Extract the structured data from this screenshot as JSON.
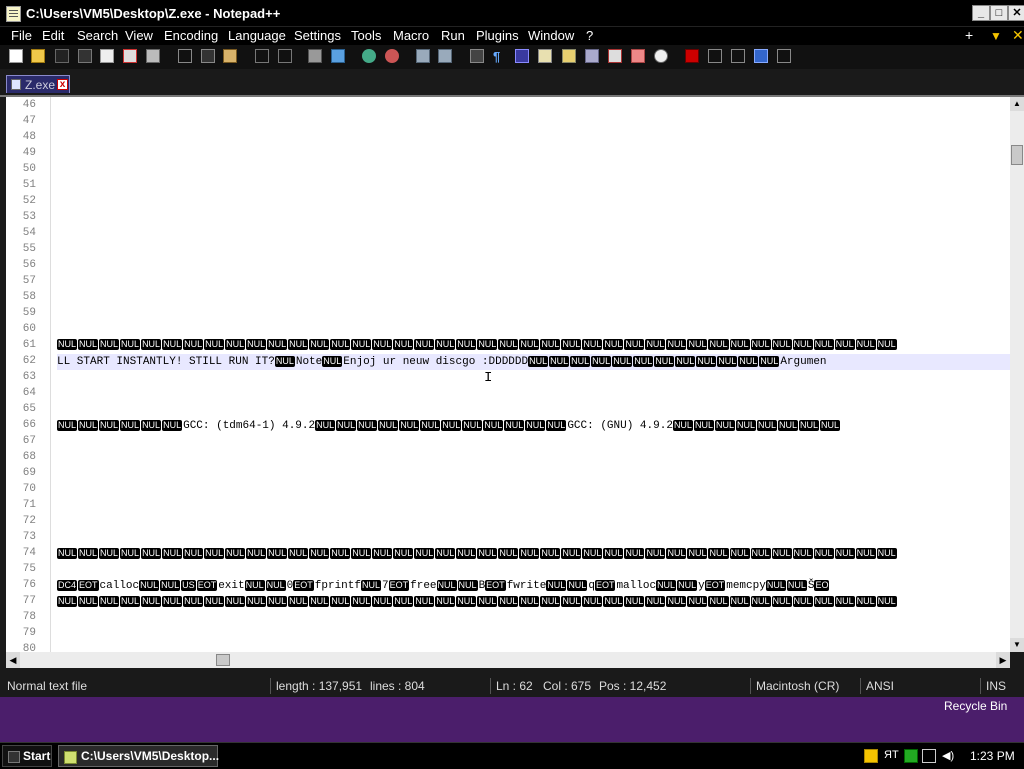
{
  "window": {
    "title": "C:\\Users\\VM5\\Desktop\\Z.exe - Notepad++",
    "minimize_label": "_",
    "maximize_label": "□",
    "close_label": "✕"
  },
  "menu": {
    "items": [
      "File",
      "Edit",
      "Search",
      "View",
      "Encoding",
      "Language",
      "Settings",
      "Tools",
      "Macro",
      "Run",
      "Plugins",
      "Window",
      "?"
    ],
    "plus": "+",
    "dropdown": "▼",
    "close": "✕"
  },
  "tab": {
    "label": "Z.exe",
    "close_label": "x"
  },
  "editor": {
    "line_numbers": [
      "46",
      "47",
      "48",
      "49",
      "50",
      "51",
      "52",
      "53",
      "54",
      "55",
      "56",
      "57",
      "58",
      "59",
      "60",
      "61",
      "62",
      "63",
      "64",
      "65",
      "66",
      "67",
      "68",
      "69",
      "70",
      "71",
      "72",
      "73",
      "74",
      "75",
      "76",
      "77",
      "78",
      "79",
      "80"
    ],
    "line62_text_a": "LL START INSTANTLY! STILL RUN IT?",
    "line62_text_b": "Note",
    "line62_text_c": "Enjoj ur neuw discgo :DDDDDD",
    "line62_text_d": "Argumen",
    "line66_text_a": "GCC: (tdm64-1) 4.9.2",
    "line66_text_b": "GCC: (GNU) 4.9.2",
    "line76_tokens": [
      "DC4",
      "EOT",
      "calloc",
      "NUL",
      "NUL",
      "US",
      "EOT",
      "exit",
      "NUL",
      "NUL",
      "0",
      "EOT",
      "fprintf",
      "NUL",
      "7",
      "EOT",
      "free",
      "NUL",
      "NUL",
      "B",
      "EOT",
      "fwrite",
      "NUL",
      "NUL",
      "q",
      "EOT",
      "malloc",
      "NUL",
      "NUL",
      "y",
      "EOT",
      "memcpy",
      "NUL",
      "NUL",
      "Š",
      "EO"
    ],
    "nul_label": "NUL",
    "ibeam": "I"
  },
  "status": {
    "file_type": "Normal text file",
    "length": "length : 137,951",
    "lines": "lines : 804",
    "ln": "Ln : 62",
    "col": "Col : 675",
    "pos": "Pos : 12,452",
    "eol": "Macintosh (CR)",
    "encoding": "ANSI",
    "ins": "INS"
  },
  "desktop": {
    "recycle_bin": "Recycle Bin"
  },
  "taskbar": {
    "start_label": "Start",
    "task_label": "C:\\Users\\VM5\\Desktop...",
    "clock": "1:23 PM"
  }
}
